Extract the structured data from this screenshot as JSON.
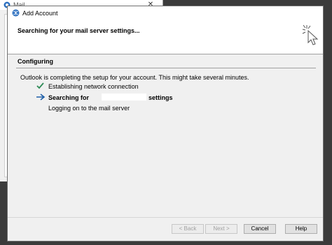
{
  "background_window": {
    "title": "Mail",
    "close_glyph": "✕"
  },
  "dialog": {
    "title": "Add Account",
    "header": "Searching for your mail server settings...",
    "section_title": "Configuring",
    "status_message": "Outlook is completing the setup for your account. This might take several minutes.",
    "steps": [
      {
        "label": "Establishing network connection",
        "state": "done",
        "icon": "checkmark-icon"
      },
      {
        "label": "Searching for",
        "suffix": "settings",
        "state": "active",
        "icon": "arrow-right-icon"
      },
      {
        "label": "Logging on to the mail server",
        "state": "pending",
        "icon": ""
      }
    ],
    "buttons": {
      "back": "< Back",
      "next": "Next >",
      "cancel": "Cancel",
      "help": "Help"
    }
  },
  "colors": {
    "check": "#2e8b57",
    "arrow": "#1f5fa8",
    "icon_blue": "#2c6fbf"
  }
}
